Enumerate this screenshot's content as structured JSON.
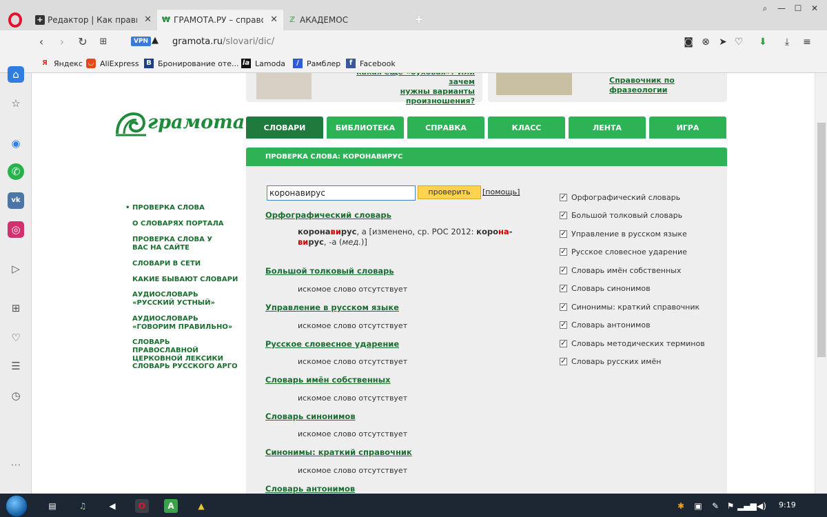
{
  "browser": {
    "tabs": [
      {
        "label": "Редактор | Как правильно",
        "icon": "plus-square-icon",
        "active": false
      },
      {
        "label": "ГРАМОТА.РУ – справочно",
        "icon": "gramota-icon",
        "active": true
      },
      {
        "label": "АКАДЕМОС",
        "icon": "akademos-icon",
        "active": false
      }
    ],
    "address": {
      "vpn": "VPN",
      "host": "gramota.ru",
      "path": "/slovari/dic/"
    },
    "bookmarks": [
      {
        "label": "Яндекс",
        "icon": "yandex-icon",
        "color": "#e62e2e"
      },
      {
        "label": "AliExpress",
        "icon": "aliexpress-icon",
        "color": "#e7451a"
      },
      {
        "label": "Бронирование оте...",
        "icon": "booking-icon",
        "color": "#1d3f86"
      },
      {
        "label": "Lamoda",
        "icon": "lamoda-icon",
        "color": "#111111"
      },
      {
        "label": "Рамблер",
        "icon": "rambler-icon",
        "color": "#2e5bd8"
      },
      {
        "label": "Facebook",
        "icon": "facebook-icon",
        "color": "#3b5998"
      }
    ]
  },
  "promo": {
    "left_link_line1": "какая еще «буховая»? Или зачем",
    "left_link_line2": "нужны варианты произношения?",
    "right_link": "Справочник по фразеологии"
  },
  "site": {
    "logo": "грамота.ру",
    "menu": [
      "СЛОВАРИ",
      "БИБЛИОТЕКА",
      "СПРАВКА",
      "КЛАСС",
      "ЛЕНТА",
      "ИГРА"
    ],
    "panel_title": "ПРОВЕРКА СЛОВА: КОРОНАВИРУС",
    "leftnav": [
      "ПРОВЕРКА СЛОВА",
      "О СЛОВАРЯХ ПОРТАЛА",
      "ПРОВЕРКА СЛОВА У ВАС НА САЙТЕ",
      "СЛОВАРИ В СЕТИ",
      "КАКИЕ БЫВАЮТ СЛОВАРИ",
      "АУДИОСЛОВАРЬ «РУССКИЙ УСТНЫЙ»",
      "АУДИОСЛОВАРЬ «ГОВОРИМ ПРАВИЛЬНО»",
      "СЛОВАРЬ ПРАВОСЛАВНОЙ ЦЕРКОВНОЙ ЛЕКСИКИ",
      "СЛОВАРЬ РУССКОГО АРГО"
    ],
    "search": {
      "value": "коронавирус",
      "button": "проверить",
      "help": "[помощь]"
    },
    "entry": {
      "dict": "Орфографический словарь",
      "word_a": "корона",
      "word_b": "ви",
      "word_c": "рус",
      "rest1": ", а [изменено, ср. РОС 2012: ",
      "form_a": "коро",
      "form_b": "на",
      "form_c": "-",
      "form_d": "ви",
      "form_e": "рус",
      "rest2": ", -а (",
      "rest3": "мед.",
      "rest4": ")]"
    },
    "results": [
      {
        "dict": "Большой толковый словарь",
        "result": "искомое слово отсутствует"
      },
      {
        "dict": "Управление в русском языке",
        "result": "искомое слово отсутствует"
      },
      {
        "dict": "Русское словесное ударение",
        "result": "искомое слово отсутствует"
      },
      {
        "dict": "Словарь имён собственных",
        "result": "искомое слово отсутствует"
      },
      {
        "dict": "Словарь синонимов",
        "result": "искомое слово отсутствует"
      },
      {
        "dict": "Синонимы: краткий справочник",
        "result": "искомое слово отсутствует"
      },
      {
        "dict": "Словарь антонимов",
        "result": ""
      }
    ],
    "checklist": [
      "Орфографический словарь",
      "Большой толковый словарь",
      "Управление в русском языке",
      "Русское словесное ударение",
      "Словарь имён собственных",
      "Словарь синонимов",
      "Синонимы: краткий справочник",
      "Словарь антонимов",
      "Словарь методических терминов",
      "Словарь русских имён"
    ]
  },
  "taskbar": {
    "clock": "9:19"
  }
}
